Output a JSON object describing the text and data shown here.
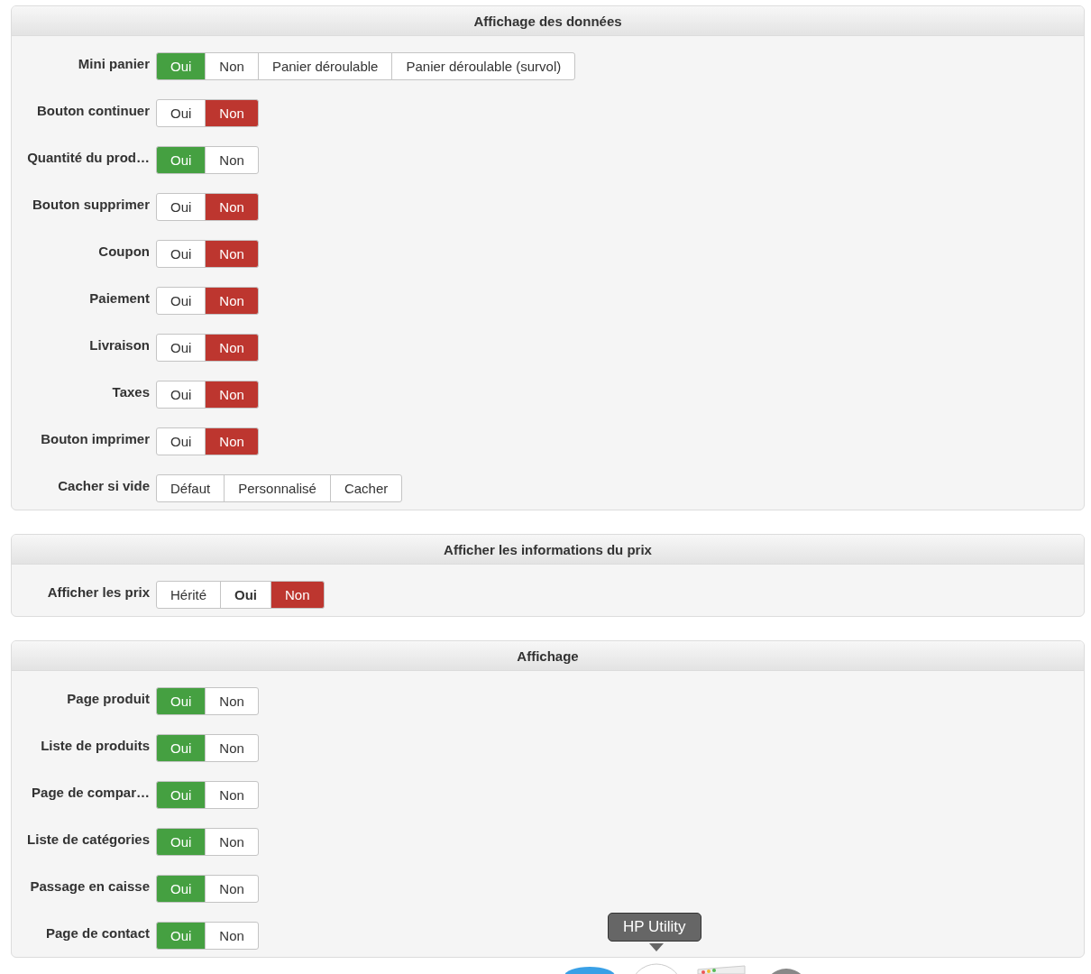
{
  "panels": [
    {
      "title": "Affichage des données",
      "rows": [
        {
          "label": "Mini panier",
          "options": [
            {
              "text": "Oui",
              "kind": "yes",
              "selected": true
            },
            {
              "text": "Non",
              "kind": "no",
              "selected": false
            },
            {
              "text": "Panier déroulable",
              "kind": "neutral",
              "selected": false
            },
            {
              "text": "Panier déroulable (survol)",
              "kind": "neutral",
              "selected": false
            }
          ]
        },
        {
          "label": "Bouton continuer",
          "options": [
            {
              "text": "Oui",
              "kind": "yes",
              "selected": false
            },
            {
              "text": "Non",
              "kind": "no",
              "selected": true
            }
          ]
        },
        {
          "label": "Quantité du prod…",
          "options": [
            {
              "text": "Oui",
              "kind": "yes",
              "selected": true
            },
            {
              "text": "Non",
              "kind": "no",
              "selected": false
            }
          ]
        },
        {
          "label": "Bouton supprimer",
          "options": [
            {
              "text": "Oui",
              "kind": "yes",
              "selected": false
            },
            {
              "text": "Non",
              "kind": "no",
              "selected": true
            }
          ]
        },
        {
          "label": "Coupon",
          "options": [
            {
              "text": "Oui",
              "kind": "yes",
              "selected": false
            },
            {
              "text": "Non",
              "kind": "no",
              "selected": true
            }
          ]
        },
        {
          "label": "Paiement",
          "options": [
            {
              "text": "Oui",
              "kind": "yes",
              "selected": false
            },
            {
              "text": "Non",
              "kind": "no",
              "selected": true
            }
          ]
        },
        {
          "label": "Livraison",
          "options": [
            {
              "text": "Oui",
              "kind": "yes",
              "selected": false
            },
            {
              "text": "Non",
              "kind": "no",
              "selected": true
            }
          ]
        },
        {
          "label": "Taxes",
          "options": [
            {
              "text": "Oui",
              "kind": "yes",
              "selected": false
            },
            {
              "text": "Non",
              "kind": "no",
              "selected": true
            }
          ]
        },
        {
          "label": "Bouton imprimer",
          "options": [
            {
              "text": "Oui",
              "kind": "yes",
              "selected": false
            },
            {
              "text": "Non",
              "kind": "no",
              "selected": true
            }
          ]
        },
        {
          "label": "Cacher si vide",
          "options": [
            {
              "text": "Défaut",
              "kind": "neutral",
              "selected": false
            },
            {
              "text": "Personnalisé",
              "kind": "neutral",
              "selected": false
            },
            {
              "text": "Cacher",
              "kind": "neutral",
              "selected": false
            }
          ]
        }
      ]
    },
    {
      "title": "Afficher les informations du prix",
      "rows": [
        {
          "label": "Afficher les prix",
          "options": [
            {
              "text": "Hérité",
              "kind": "neutral",
              "selected": false
            },
            {
              "text": "Oui",
              "kind": "inherited",
              "selected": false
            },
            {
              "text": "Non",
              "kind": "no",
              "selected": true
            }
          ]
        }
      ]
    },
    {
      "title": "Affichage",
      "rows": [
        {
          "label": "Page produit",
          "options": [
            {
              "text": "Oui",
              "kind": "yes",
              "selected": true
            },
            {
              "text": "Non",
              "kind": "no",
              "selected": false
            }
          ]
        },
        {
          "label": "Liste de produits",
          "options": [
            {
              "text": "Oui",
              "kind": "yes",
              "selected": true
            },
            {
              "text": "Non",
              "kind": "no",
              "selected": false
            }
          ]
        },
        {
          "label": "Page de compar…",
          "options": [
            {
              "text": "Oui",
              "kind": "yes",
              "selected": true
            },
            {
              "text": "Non",
              "kind": "no",
              "selected": false
            }
          ]
        },
        {
          "label": "Liste de catégories",
          "options": [
            {
              "text": "Oui",
              "kind": "yes",
              "selected": true
            },
            {
              "text": "Non",
              "kind": "no",
              "selected": false
            }
          ]
        },
        {
          "label": "Passage en caisse",
          "options": [
            {
              "text": "Oui",
              "kind": "yes",
              "selected": true
            },
            {
              "text": "Non",
              "kind": "no",
              "selected": false
            }
          ]
        },
        {
          "label": "Page de contact",
          "options": [
            {
              "text": "Oui",
              "kind": "yes",
              "selected": true
            },
            {
              "text": "Non",
              "kind": "no",
              "selected": false
            }
          ]
        }
      ]
    }
  ],
  "dock": {
    "tooltip": "HP Utility"
  }
}
